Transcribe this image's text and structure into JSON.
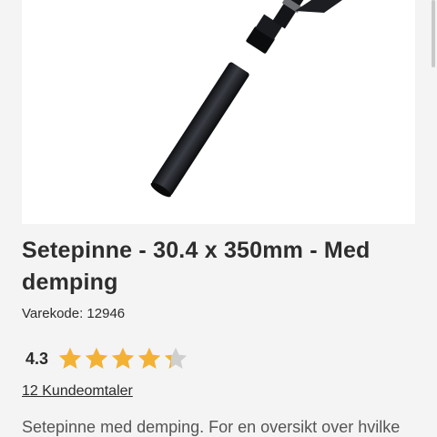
{
  "product": {
    "image_alt": "Setepinne produktbilde",
    "title": "Setepinne - 30.4 x 350mm - Med demping",
    "sku": "Varekode: 12946",
    "rating": {
      "value_label": "4.3",
      "score": 4.3,
      "max": 5,
      "star_color": "#f3b234",
      "empty_color": "#cfcfcf"
    },
    "reviews_link": "12 Kundeomtaler",
    "description": "Setepinne med demping. For en oversikt over hvilke"
  }
}
